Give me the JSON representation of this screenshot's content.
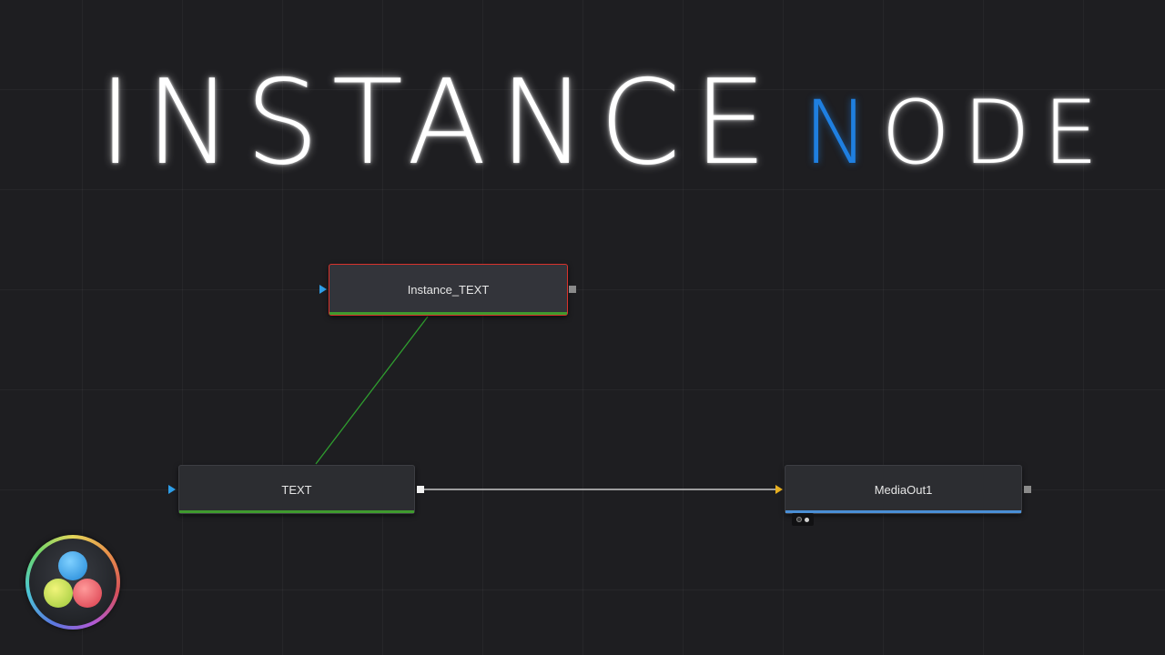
{
  "title": {
    "main": "INSTANCE",
    "accent_letter": "N",
    "rest": "ODE"
  },
  "colors": {
    "background": "#1e1e21",
    "title_accent": "#1f7fe0",
    "selected_outline": "#d8322c",
    "link_instance": "#2f9e2f",
    "link_main": "#e8e8e8",
    "bar_green": "#3f9a2e",
    "bar_blue": "#4a8fd6",
    "input_blue": "#2e9ee8",
    "input_yellow": "#e8b020"
  },
  "nodes": {
    "instance_text": {
      "label": "Instance_TEXT",
      "selected": true
    },
    "text": {
      "label": "TEXT"
    },
    "media_out": {
      "label": "MediaOut1"
    }
  },
  "logo": {
    "icon": "davinci-resolve-logo-icon"
  }
}
